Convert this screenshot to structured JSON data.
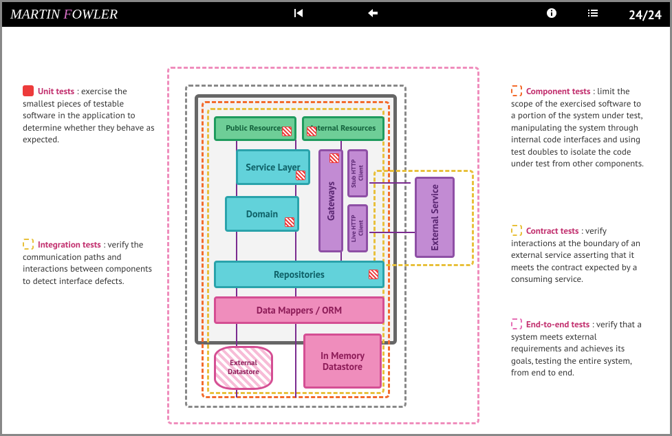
{
  "header": {
    "brand_martin": "MARTIN ",
    "brand_f": "F",
    "brand_owler": "OWLER",
    "page_counter": "24/24"
  },
  "legends": {
    "unit": {
      "title": "Unit tests",
      "desc": " : exercise the smallest pieces of testable software in the application to determine whether they behave as expected."
    },
    "integration": {
      "title": "Integration tests",
      "desc": " : verify the communication paths and interactions between components to detect interface defects."
    },
    "component": {
      "title": "Component tests",
      "desc": " : limit the scope of the exercised software to a portion of the system under test, manipulating the system through internal code interfaces and using test doubles to isolate the code under test from other components."
    },
    "contract": {
      "title": "Contract tests",
      "desc": " : verify interactions at the boundary of an external service asserting that it meets the contract expected by a consuming service."
    },
    "e2e": {
      "title": "End-to-end tests",
      "desc": " : verify that a system meets external requirements and achieves its goals, testing the entire system, from end to end."
    }
  },
  "boxes": {
    "public_resources": "Public Resources",
    "internal_resources": "Internal Resources",
    "service_layer": "Service Layer",
    "domain": "Domain",
    "gateways": "Gateways",
    "stub_http": "Stub HTTP Client",
    "live_http": "Live HTTP Client",
    "external_service": "External Service",
    "repositories": "Repositories",
    "data_mappers": "Data Mappers / ORM",
    "in_memory": "In Memory Datastore",
    "external_datastore": "External Datastore"
  },
  "colors": {
    "unit": "#ed3b3b",
    "integration": "#e8c03b",
    "component": "#f36b2c",
    "e2e": "#ef8dbc"
  }
}
